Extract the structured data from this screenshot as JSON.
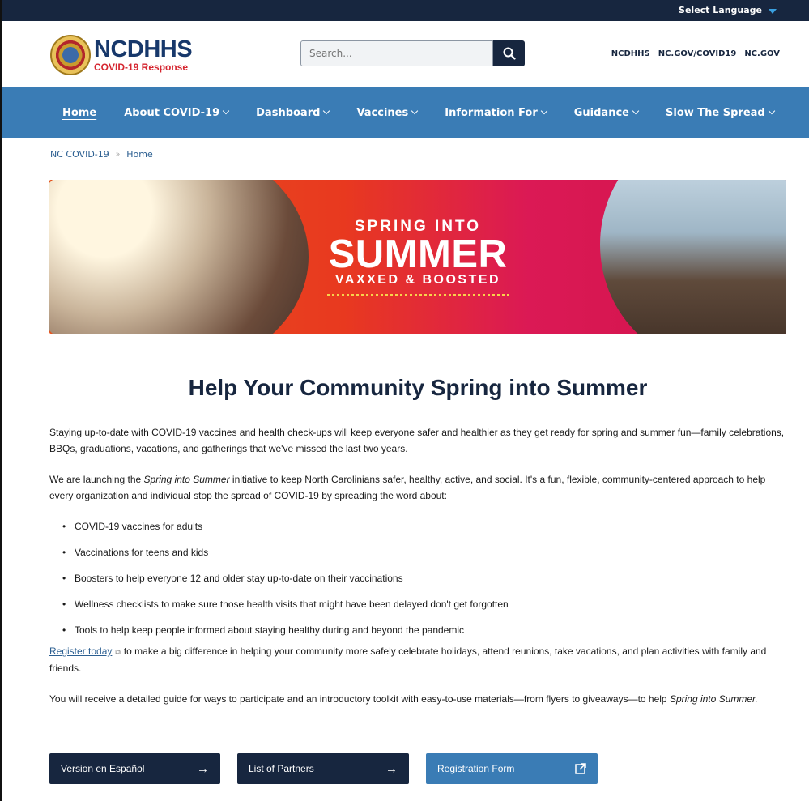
{
  "utility": {
    "language_label": "Select Language"
  },
  "header": {
    "logo_title": "NCDHHS",
    "logo_subtitle": "COVID-19 Response",
    "search_placeholder": "Search...",
    "links": [
      "NCDHHS",
      "NC.GOV/COVID19",
      "NC.GOV"
    ]
  },
  "nav": [
    {
      "label": "Home",
      "dropdown": false
    },
    {
      "label": "About COVID-19",
      "dropdown": true
    },
    {
      "label": "Dashboard",
      "dropdown": true
    },
    {
      "label": "Vaccines",
      "dropdown": true
    },
    {
      "label": "Information For",
      "dropdown": true
    },
    {
      "label": "Guidance",
      "dropdown": true
    },
    {
      "label": "Slow The Spread",
      "dropdown": true
    }
  ],
  "breadcrumb": {
    "parent": "NC COVID-19",
    "separator": "»",
    "current": "Home"
  },
  "hero": {
    "line1": "SPRING INTO",
    "line2": "SUMMER",
    "line3": "VAXXED & BOOSTED"
  },
  "main": {
    "title": "Help Your Community Spring into Summer",
    "para1": "Staying up-to-date with COVID-19 vaccines and health check-ups will keep everyone safer and healthier as they get ready for spring and summer fun—family celebrations, BBQs, graduations, vacations, and gatherings that we've missed the last two years.",
    "para2_pre": "We are launching the ",
    "para2_em": "Spring into Summer",
    "para2_post": " initiative to keep North Carolinians safer, healthy, active, and social. It's a fun, flexible, community-centered approach to help every organization and individual stop the spread of COVID-19 by spreading the word about:",
    "bullets": [
      "COVID-19 vaccines for adults",
      "Vaccinations for teens and kids",
      "Boosters to help everyone 12 and older stay up-to-date on their vaccinations",
      "Wellness checklists to make sure those health visits that might have been delayed don't get forgotten",
      "Tools to help keep people informed about staying healthy during and beyond the pandemic"
    ],
    "register_link": "Register today",
    "para3_post": "to make a big difference in helping your community more safely celebrate holidays, attend reunions, take vacations, and plan activities with family and friends.",
    "para4_pre": "You will receive a detailed guide for ways to participate and an introductory toolkit with easy-to-use materials—from flyers to giveaways—to help ",
    "para4_em": "Spring into Summer."
  },
  "buttons": {
    "spanish": "Version en Español",
    "partners": "List of Partners",
    "registration": "Registration Form"
  },
  "colors": {
    "navy": "#17263f",
    "nav_blue": "#3a7cb5",
    "accent_red": "#d52630"
  }
}
